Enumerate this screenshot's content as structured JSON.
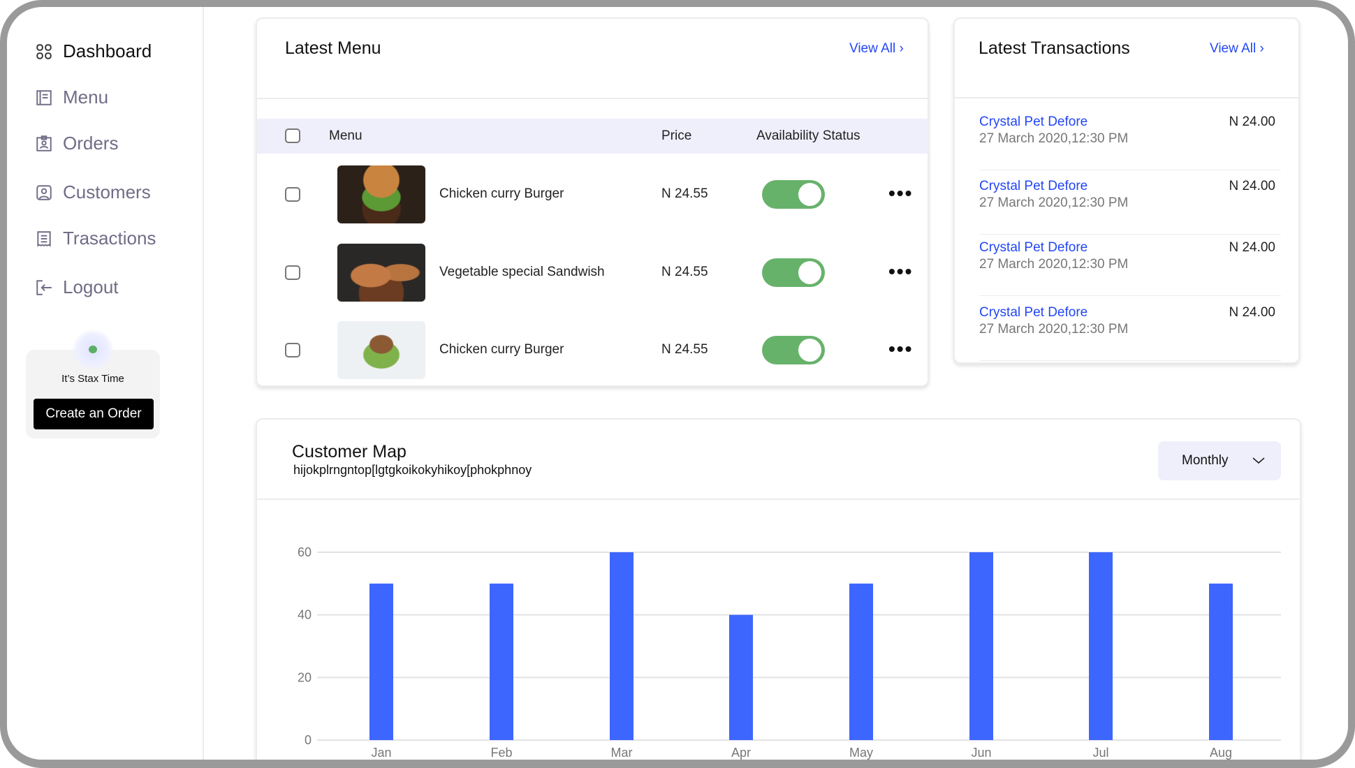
{
  "sidebar": {
    "items": [
      {
        "label": "Dashboard",
        "icon": "grid-icon",
        "active": true
      },
      {
        "label": "Menu",
        "icon": "book-icon"
      },
      {
        "label": "Orders",
        "icon": "clipboard-icon"
      },
      {
        "label": "Customers",
        "icon": "user-icon"
      },
      {
        "label": "Trasactions",
        "icon": "receipt-icon"
      },
      {
        "label": "Logout",
        "icon": "logout-icon"
      }
    ],
    "promo": {
      "text": "It’s Stax Time",
      "button": "Create an Order"
    }
  },
  "latest_menu": {
    "title": "Latest Menu",
    "view_all": "View All",
    "columns": [
      "Menu",
      "Price",
      "Availability Status"
    ],
    "rows": [
      {
        "name": "Chicken curry Burger",
        "price": "N 24.55",
        "available": true
      },
      {
        "name": "Vegetable special Sandwish",
        "price": "N 24.55",
        "available": true
      },
      {
        "name": "Chicken curry Burger",
        "price": "N 24.55",
        "available": true
      }
    ]
  },
  "latest_transactions": {
    "title": "Latest Transactions",
    "view_all": "View All",
    "items": [
      {
        "name": "Crystal Pet Defore",
        "date": "27 March 2020,12:30 PM",
        "amount": "N 24.00"
      },
      {
        "name": "Crystal Pet Defore",
        "date": "27 March 2020,12:30 PM",
        "amount": "N 24.00"
      },
      {
        "name": "Crystal Pet Defore",
        "date": "27 March 2020,12:30 PM",
        "amount": "N 24.00"
      },
      {
        "name": "Crystal Pet Defore",
        "date": "27 March 2020,12:30 PM",
        "amount": "N 24.00"
      }
    ]
  },
  "customer_map": {
    "title": "Customer Map",
    "subtitle": "hijokplrngntop[lgtgkoikokyhikoy[phokphnoy",
    "period": "Monthly"
  },
  "colors": {
    "accent": "#2346f5",
    "bar": "#3d66ff",
    "toggle_on": "#67b26b",
    "header_bg": "#efeffc"
  },
  "chart_data": {
    "type": "bar",
    "categories": [
      "Jan",
      "Feb",
      "Mar",
      "Apr",
      "May",
      "Jun",
      "Jul",
      "Aug"
    ],
    "values": [
      50,
      50,
      60,
      40,
      50,
      60,
      60,
      50
    ],
    "yticks": [
      0,
      20,
      40,
      60
    ],
    "ylim": [
      0,
      60
    ],
    "grid": true
  }
}
